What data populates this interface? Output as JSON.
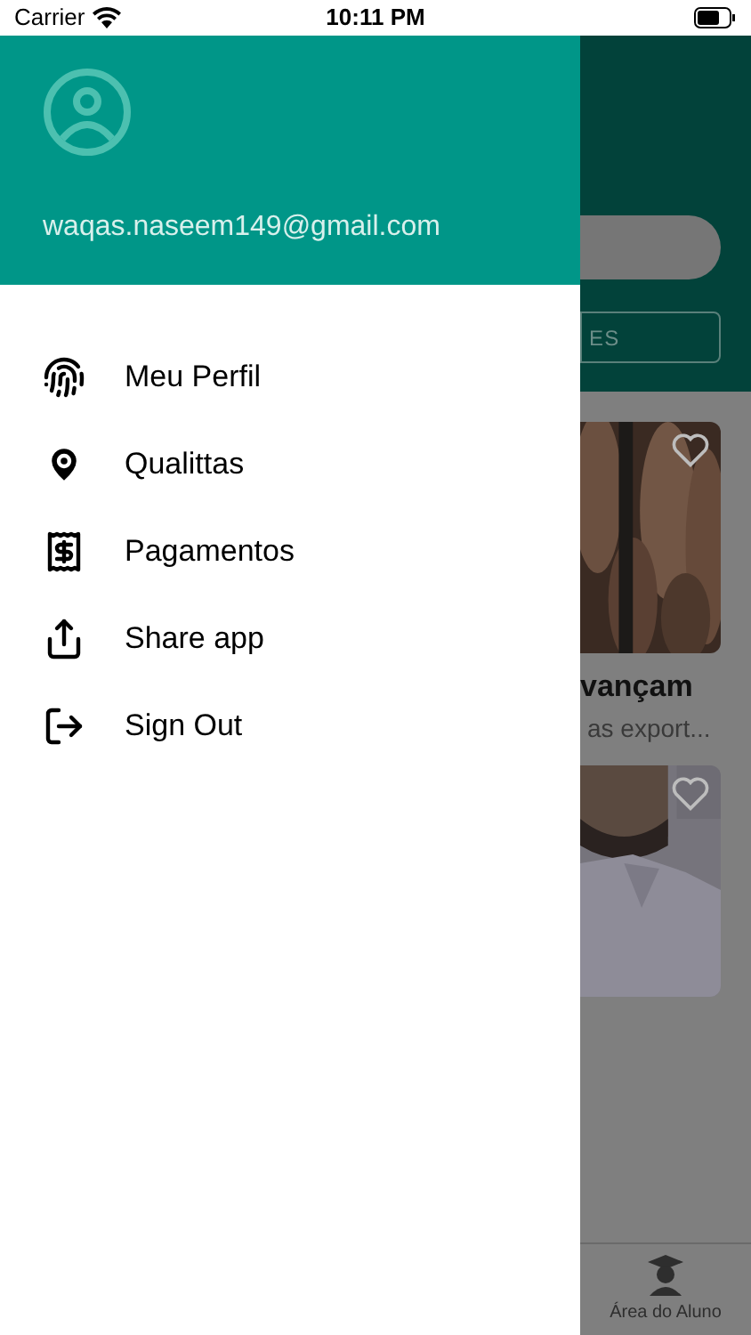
{
  "status_bar": {
    "carrier": "Carrier",
    "time": "10:11 PM"
  },
  "drawer": {
    "email": "waqas.naseem149@gmail.com",
    "items": [
      {
        "kind": "profile",
        "label": "Meu Perfil"
      },
      {
        "kind": "place",
        "label": "Qualittas"
      },
      {
        "kind": "payment",
        "label": "Pagamentos"
      },
      {
        "kind": "share",
        "label": "Share app"
      },
      {
        "kind": "signout",
        "label": "Sign Out"
      }
    ]
  },
  "background": {
    "button_label": "ES",
    "cards": [
      {
        "kind": "fur",
        "title": "vançam",
        "subtitle": "as export..."
      },
      {
        "kind": "person"
      }
    ],
    "tab_bar": [
      {
        "label": "Área do Aluno"
      }
    ]
  }
}
